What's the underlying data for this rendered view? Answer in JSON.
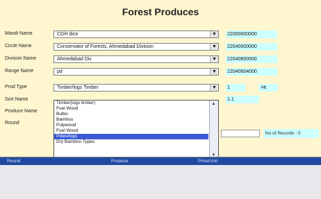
{
  "title": "Forest Produces",
  "fields": [
    {
      "label": "Mandi Name",
      "value": "CGH dice",
      "code": "22000000000"
    },
    {
      "label": "Circle Name",
      "value": "Conservator of Forests, Ahmedabad Division",
      "code": "22040000000"
    },
    {
      "label": "Division Name",
      "value": "Ahmedabad Div",
      "code": "22040600000"
    },
    {
      "label": "Range Name",
      "value": "pd",
      "code": "22040604000"
    },
    {
      "label": "Prod Type",
      "value": "Timber/logs Timber",
      "code": "1"
    }
  ],
  "unit_label": "Hr.",
  "more_labels": [
    "Sort Name",
    "Produce Name",
    "Round"
  ],
  "sort_code": "1.1",
  "dropdown_items": [
    "Timber(logs timber)",
    "Fuel Wood",
    "Bulbo",
    "Bamboo",
    "Pulpwood",
    "Fuel Wood",
    "Poles/logs",
    "Dry Bamboo Types"
  ],
  "dropdown_selected_index": 6,
  "records_label": "No of Records : 0",
  "grid_headers": [
    "Round",
    "Produce",
    "Price/Unit"
  ]
}
